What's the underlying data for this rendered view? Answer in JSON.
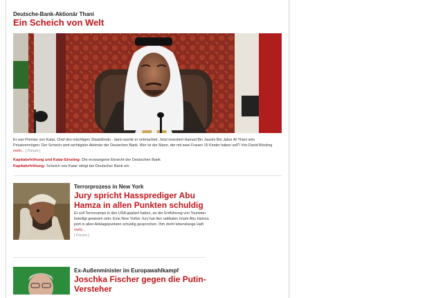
{
  "lead": {
    "kicker": "Deutsche-Bank-Aktionär Thani",
    "headline": "Ein Scheich von Welt",
    "image": "portrait-photo",
    "teaser": "Er war Premier von Katar, Chef des mächtigen Staatsfonds - dann wurde er entmachtet. Jetzt investiert Hamad Bin Jassim Bin Jabor Al-Thani sein Privatvermögen: Der Scheich wird wichtigster Aktionär der Deutschen Bank. Wer ist der Mann, der mit zwei Frauen 15 Kinder haben soll? Von David Böcking",
    "more": "mehr...",
    "forum": "[ Forum ]",
    "related": [
      {
        "label": "Kapitalerhöhung und Katar-Einstieg:",
        "text": "Die erzwungene Einsicht der Deutschen Bank"
      },
      {
        "label": "Kapitalerhöhung:",
        "text": "Scheich von Katar steigt bei Deutscher Bank ein"
      }
    ]
  },
  "articles": [
    {
      "kicker": "Terrorprozess in New York",
      "headline": "Jury spricht Hassprediger Abu Hamza in allen Punkten schuldig",
      "teaser": "Er soll Terrorcamps in den USA geplant haben, an der Entführung von Touristen beteiligt gewesen sein: Eine New Yorker Jury hat den radikalen Imam Abu Hamza jetzt in allen Anklagepunkten schuldig gesprochen. Ihm droht lebenslange Haft",
      "more": "mehr...",
      "forum": "[ Forum ]"
    },
    {
      "kicker": "Ex-Außenminister im Europawahlkampf",
      "headline": "Joschka Fischer gegen die Putin-Versteher"
    }
  ],
  "colors": {
    "accent": "#c0161b",
    "text": "#222222",
    "divider": "#e3e3e3"
  }
}
